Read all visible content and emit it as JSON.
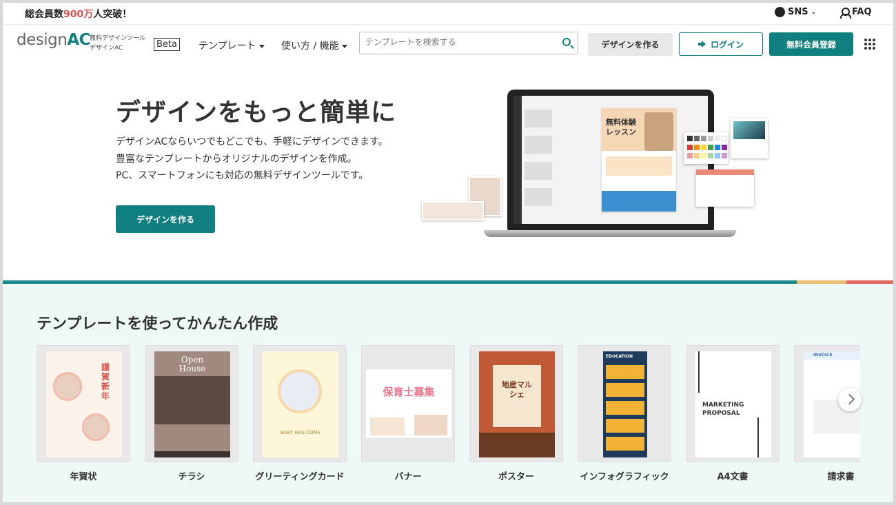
{
  "topbar": {
    "members_prefix": "総会員数",
    "members_count": "900万",
    "members_suffix": "人突破！",
    "sns_label": "SNS",
    "faq_label": "FAQ"
  },
  "header": {
    "logo_text": "design",
    "logo_ac": "AC",
    "logo_sub1": "無料デザインツール",
    "logo_sub2": "デザインAC",
    "beta": "Beta",
    "nav_templates": "テンプレート",
    "nav_howto": "使い方 / 機能",
    "search_placeholder": "テンプレートを検索する",
    "btn_design": "デザインを作る",
    "btn_login": "ログイン",
    "btn_register": "無料会員登録"
  },
  "hero": {
    "title": "デザインをもっと簡単に",
    "line1": "デザインACならいつでもどこでも、手軽にデザインできます。",
    "line2": "豊富なテンプレートからオリジナルのデザインを作成。",
    "line3": "PC、スマートフォンにも対応の無料デザインツールです。",
    "cta": "デザインを作る",
    "mock_doc_title1": "無料体験",
    "mock_doc_title2": "レッスン"
  },
  "templates": {
    "title": "テンプレートを使ってかんたん作成",
    "items": [
      {
        "label": "年賀状",
        "art_text": "謹賀新年"
      },
      {
        "label": "チラシ",
        "art_text": "Open House"
      },
      {
        "label": "グリーティングカード",
        "art_text": "BABY HAS COME"
      },
      {
        "label": "バナー",
        "art_text": "保育士募集"
      },
      {
        "label": "ポスター",
        "art_text": "地産マルシェ"
      },
      {
        "label": "インフォグラフィック",
        "art_text": "EDUCATION"
      },
      {
        "label": "A4文書",
        "art_text": "MARKETING PROPOSAL"
      },
      {
        "label": "請求書",
        "art_text": "INVOICE"
      }
    ]
  },
  "colors": {
    "accent": "#0f7f80",
    "highlight": "#d9534f",
    "section_bg": "#eef8f6"
  }
}
